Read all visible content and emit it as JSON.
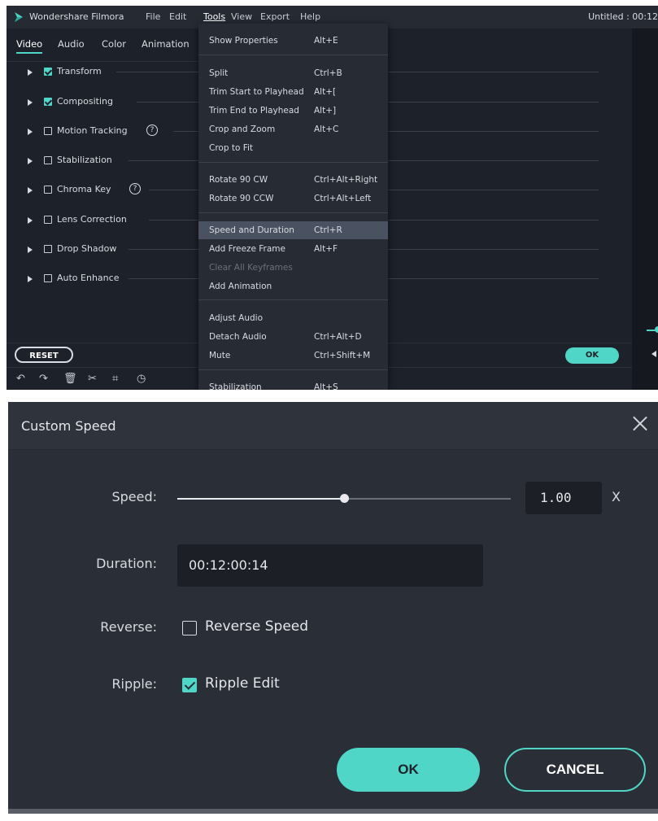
{
  "editor": {
    "app_name": "Wondershare Filmora",
    "menubar": [
      "File",
      "Edit",
      "Tools",
      "View",
      "Export",
      "Help"
    ],
    "active_menu": "Tools",
    "document_title": "Untitled : 00:12",
    "tabs": [
      "Video",
      "Audio",
      "Color",
      "Animation"
    ],
    "active_tab": "Video",
    "properties": [
      {
        "label": "Transform",
        "checked": true,
        "help": false
      },
      {
        "label": "Compositing",
        "checked": true,
        "help": false
      },
      {
        "label": "Motion Tracking",
        "checked": false,
        "help": true
      },
      {
        "label": "Stabilization",
        "checked": false,
        "help": false
      },
      {
        "label": "Chroma Key",
        "checked": false,
        "help": true
      },
      {
        "label": "Lens Correction",
        "checked": false,
        "help": false
      },
      {
        "label": "Drop Shadow",
        "checked": false,
        "help": false
      },
      {
        "label": "Auto Enhance",
        "checked": false,
        "help": false
      }
    ],
    "help_glyph": "?",
    "reset_label": "RESET",
    "ok_label": "OK",
    "toolbar_icons": [
      "undo-icon",
      "redo-icon",
      "delete-icon",
      "cut-icon",
      "crop-icon",
      "speed-icon"
    ],
    "tools_menu": [
      {
        "name": "Show Properties",
        "key": "Alt+E"
      },
      {
        "name": "Split",
        "key": "Ctrl+B"
      },
      {
        "name": "Trim Start to Playhead",
        "key": "Alt+["
      },
      {
        "name": "Trim End to Playhead",
        "key": "Alt+]"
      },
      {
        "name": "Crop and Zoom",
        "key": "Alt+C"
      },
      {
        "name": "Crop to Fit",
        "key": ""
      },
      {
        "name": "Rotate 90 CW",
        "key": "Ctrl+Alt+Right"
      },
      {
        "name": "Rotate 90 CCW",
        "key": "Ctrl+Alt+Left"
      },
      {
        "name": "Speed and Duration",
        "key": "Ctrl+R",
        "highlighted": true
      },
      {
        "name": "Add Freeze Frame",
        "key": "Alt+F"
      },
      {
        "name": "Clear All Keyframes",
        "key": "",
        "disabled": true
      },
      {
        "name": "Add Animation",
        "key": ""
      },
      {
        "name": "Adjust Audio",
        "key": ""
      },
      {
        "name": "Detach Audio",
        "key": "Ctrl+Alt+D"
      },
      {
        "name": "Mute",
        "key": "Ctrl+Shift+M"
      },
      {
        "name": "Stabilization",
        "key": "Alt+S"
      }
    ]
  },
  "dialog": {
    "title": "Custom Speed",
    "speed_label": "Speed:",
    "speed_value": "1.00",
    "speed_unit": "X",
    "speed_slider_fraction": 0.5,
    "duration_label": "Duration:",
    "duration_value": "00:12:00:14",
    "reverse_label": "Reverse:",
    "reverse_text": "Reverse Speed",
    "reverse_checked": false,
    "ripple_label": "Ripple:",
    "ripple_text": "Ripple Edit",
    "ripple_checked": true,
    "ok_label": "OK",
    "cancel_label": "CANCEL"
  },
  "colors": {
    "accent": "#4fd6c6",
    "panel_bg": "#1d2129",
    "dialog_bg": "#2a2e36",
    "menu_highlight": "#4a5261"
  }
}
